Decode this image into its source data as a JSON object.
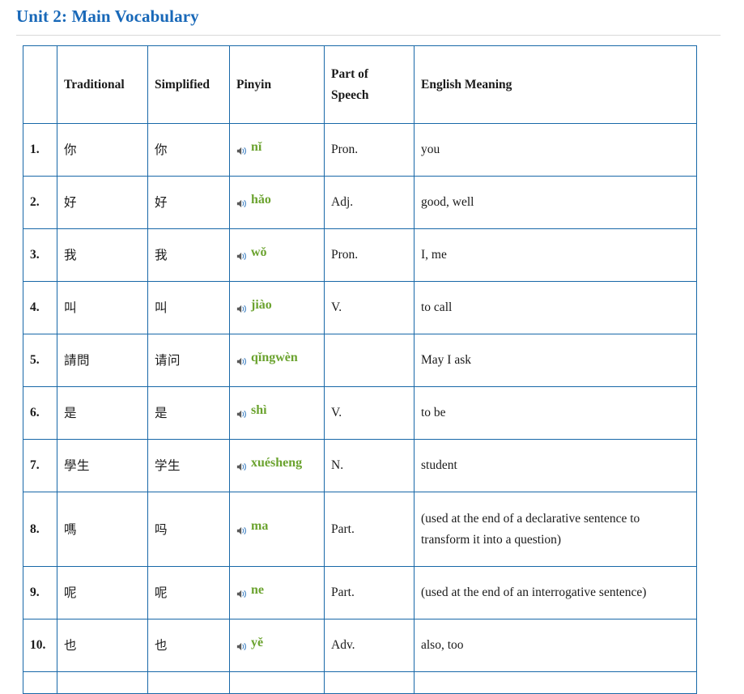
{
  "header": {
    "title": "Unit 2: Main Vocabulary"
  },
  "colors": {
    "title": "#1868b8",
    "table_border": "#1868a8",
    "pinyin": "#6ba32f",
    "speaker_body": "#5a5a5a",
    "speaker_waves": "#3d7fc1",
    "rule": "#d8d8d8"
  },
  "table": {
    "columns": [
      {
        "key": "num",
        "label": ""
      },
      {
        "key": "trad",
        "label": "Traditional"
      },
      {
        "key": "simp",
        "label": "Simplified"
      },
      {
        "key": "pin",
        "label": "Pinyin"
      },
      {
        "key": "pos",
        "label": "Part of Speech"
      },
      {
        "key": "eng",
        "label": "English Meaning"
      }
    ],
    "audio_icon": "speaker-icon",
    "rows": [
      {
        "num": "1.",
        "traditional": "你",
        "simplified": "你",
        "pinyin": "nǐ",
        "part_of_speech": "Pron.",
        "english": "you"
      },
      {
        "num": "2.",
        "traditional": "好",
        "simplified": "好",
        "pinyin": "hǎo",
        "part_of_speech": "Adj.",
        "english": "good, well"
      },
      {
        "num": "3.",
        "traditional": "我",
        "simplified": "我",
        "pinyin": "wǒ",
        "part_of_speech": "Pron.",
        "english": "I, me"
      },
      {
        "num": "4.",
        "traditional": "叫",
        "simplified": "叫",
        "pinyin": "jiào",
        "part_of_speech": "V.",
        "english": "to call"
      },
      {
        "num": "5.",
        "traditional": "請問",
        "simplified": "请问",
        "pinyin": "qǐngwèn",
        "part_of_speech": "",
        "english": "May I ask"
      },
      {
        "num": "6.",
        "traditional": "是",
        "simplified": "是",
        "pinyin": "shì",
        "part_of_speech": "V.",
        "english": "to be"
      },
      {
        "num": "7.",
        "traditional": "學生",
        "simplified": "学生",
        "pinyin": "xuésheng",
        "part_of_speech": "N.",
        "english": "student"
      },
      {
        "num": "8.",
        "traditional": "嗎",
        "simplified": "吗",
        "pinyin": "ma",
        "part_of_speech": "Part.",
        "english": "(used at the end of a declarative sentence to transform it into a question)"
      },
      {
        "num": "9.",
        "traditional": "呢",
        "simplified": "呢",
        "pinyin": "ne",
        "part_of_speech": "Part.",
        "english": "(used at the end of an interrogative sentence)"
      },
      {
        "num": "10.",
        "traditional": "也",
        "simplified": "也",
        "pinyin": "yě",
        "part_of_speech": "Adv.",
        "english": "also, too"
      }
    ]
  }
}
